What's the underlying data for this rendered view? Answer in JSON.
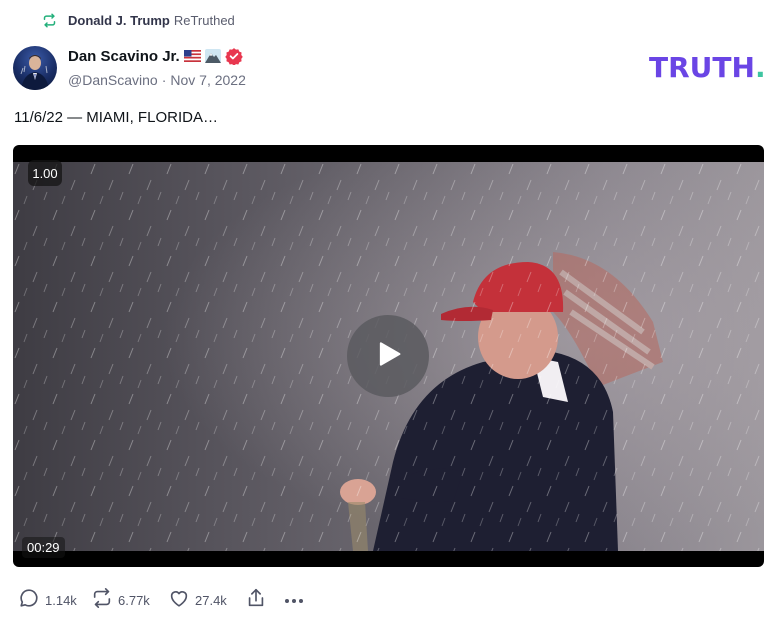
{
  "retruth_banner": {
    "user": "Donald J. Trump",
    "verb": "ReTruthed"
  },
  "author": {
    "name": "Dan Scavino Jr.",
    "handle": "@DanScavino",
    "separator": "·",
    "date": "Nov 7, 2022"
  },
  "brand": {
    "logo_text": "TRUTH",
    "logo_dot": ".",
    "primary": "#6a45e5",
    "accent": "#3ec5a1"
  },
  "post": {
    "text": "11/6/22 — MIAMI, FLORIDA…"
  },
  "video": {
    "speed": "1.00",
    "duration": "00:29"
  },
  "actions": {
    "replies": "1.14k",
    "retruths": "6.77k",
    "likes": "27.4k"
  },
  "icons": [
    "retruth-icon",
    "verified-icon",
    "play-icon",
    "reply-icon",
    "like-icon",
    "share-icon",
    "more-icon"
  ]
}
